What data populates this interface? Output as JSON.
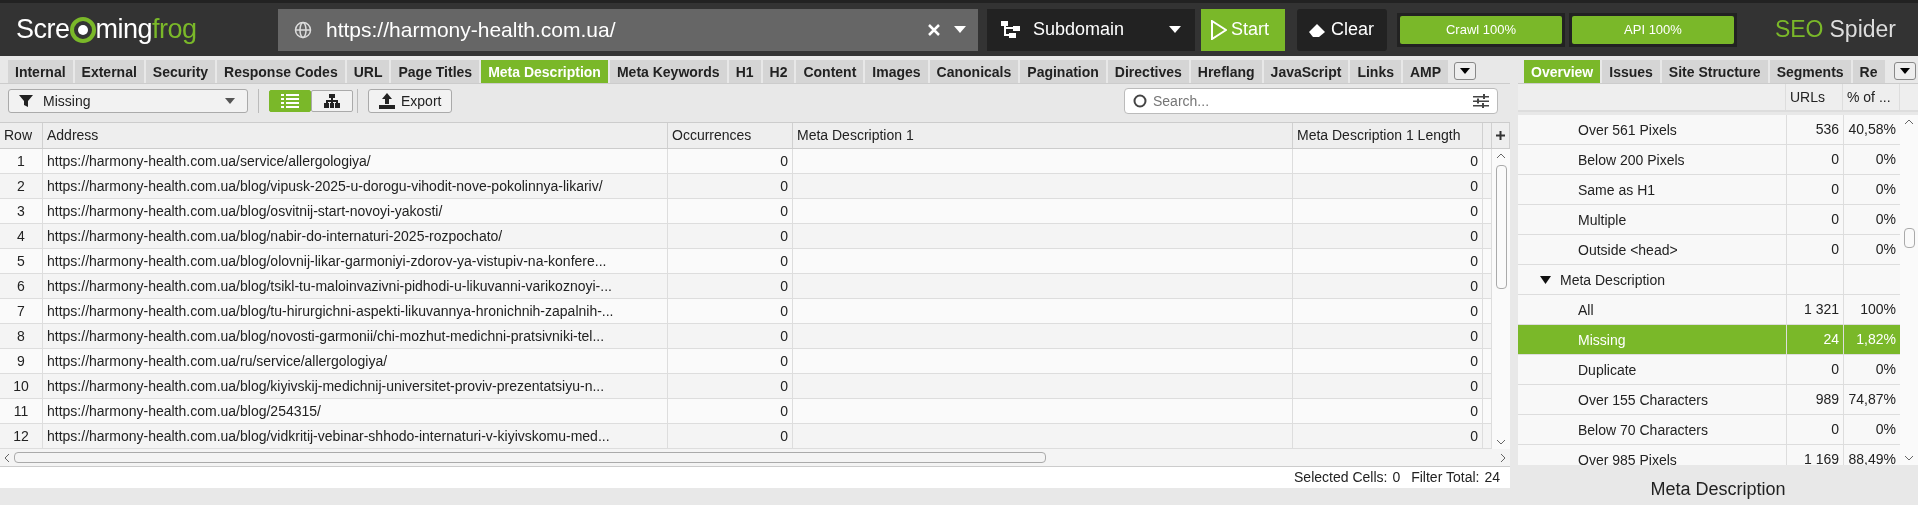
{
  "logo": {
    "part_1": "Scre",
    "part_2": "ming",
    "part_3": "frog"
  },
  "url_field": {
    "value": "https://harmony-health.com.ua/"
  },
  "mode_dropdown": {
    "value": "Subdomain"
  },
  "buttons": {
    "start": "Start",
    "clear": "Clear"
  },
  "progress": [
    {
      "label": "Crawl 100%",
      "level": 1
    },
    {
      "label": "API 100%",
      "level": 1
    }
  ],
  "product": {
    "part_1": "SEO",
    "part_2": "Spider"
  },
  "tabs": [
    {
      "label": "Internal",
      "selected": false
    },
    {
      "label": "External",
      "selected": false
    },
    {
      "label": "Security",
      "selected": false
    },
    {
      "label": "Response Codes",
      "selected": false
    },
    {
      "label": "URL",
      "selected": false
    },
    {
      "label": "Page Titles",
      "selected": false
    },
    {
      "label": "Meta Description",
      "selected": true
    },
    {
      "label": "Meta Keywords",
      "selected": false
    },
    {
      "label": "H1",
      "selected": false
    },
    {
      "label": "H2",
      "selected": false
    },
    {
      "label": "Content",
      "selected": false
    },
    {
      "label": "Images",
      "selected": false
    },
    {
      "label": "Canonicals",
      "selected": false
    },
    {
      "label": "Pagination",
      "selected": false
    },
    {
      "label": "Directives",
      "selected": false
    },
    {
      "label": "Hreflang",
      "selected": false
    },
    {
      "label": "JavaScript",
      "selected": false
    },
    {
      "label": "Links",
      "selected": false
    },
    {
      "label": "AMP",
      "selected": false
    }
  ],
  "filter": {
    "value": "Missing"
  },
  "view_buttons": [
    {
      "kind": "list",
      "selected": true
    },
    {
      "kind": "tree",
      "selected": false
    }
  ],
  "export_button": "Export",
  "search": {
    "placeholder": "Search..."
  },
  "table": {
    "columns": [
      "Row",
      "Address",
      "Occurrences",
      "Meta Description 1",
      "Meta Description 1 Length"
    ],
    "rows": [
      {
        "row": "1",
        "address": "https://harmony-health.com.ua/service/allergologiya/",
        "occurrences": "0",
        "length": "0"
      },
      {
        "row": "2",
        "address": "https://harmony-health.com.ua/blog/vipusk-2025-u-dorogu-vihodit-nove-pokolinnya-likariv/",
        "occurrences": "0",
        "length": "0"
      },
      {
        "row": "3",
        "address": "https://harmony-health.com.ua/blog/osvitnij-start-novoyi-yakosti/",
        "occurrences": "0",
        "length": "0"
      },
      {
        "row": "4",
        "address": "https://harmony-health.com.ua/blog/nabir-do-internaturi-2025-rozpochato/",
        "occurrences": "0",
        "length": "0"
      },
      {
        "row": "5",
        "address": "https://harmony-health.com.ua/blog/olovnij-likar-garmoniyi-zdorov-ya-vistupiv-na-konfere...",
        "occurrences": "0",
        "length": "0"
      },
      {
        "row": "6",
        "address": "https://harmony-health.com.ua/blog/tsikl-tu-maloinvazivni-pidhodi-u-likuvanni-varikoznoyi-...",
        "occurrences": "0",
        "length": "0"
      },
      {
        "row": "7",
        "address": "https://harmony-health.com.ua/blog/tu-hirurgichni-aspekti-likuvannya-hronichnih-zapalnih-...",
        "occurrences": "0",
        "length": "0"
      },
      {
        "row": "8",
        "address": "https://harmony-health.com.ua/blog/novosti-garmonii/chi-mozhut-medichni-pratsivniki-tel...",
        "occurrences": "0",
        "length": "0"
      },
      {
        "row": "9",
        "address": "https://harmony-health.com.ua/ru/service/allergologiya/",
        "occurrences": "0",
        "length": "0"
      },
      {
        "row": "10",
        "address": "https://harmony-health.com.ua/blog/kiyivskij-medichnij-universitet-proviv-prezentatsiyu-n...",
        "occurrences": "0",
        "length": "0"
      },
      {
        "row": "11",
        "address": "https://harmony-health.com.ua/blog/254315/",
        "occurrences": "0",
        "length": "0"
      },
      {
        "row": "12",
        "address": "https://harmony-health.com.ua/blog/vidkritij-vebinar-shhodo-internaturi-v-kiyivskomu-med...",
        "occurrences": "0",
        "length": "0"
      }
    ]
  },
  "status_bar": {
    "selected_label": "Selected Cells:",
    "selected_value": "0",
    "total_label": "Filter Total:",
    "total_value": "24"
  },
  "right_tabs": [
    {
      "label": "Overview",
      "selected": true
    },
    {
      "label": "Issues",
      "selected": false
    },
    {
      "label": "Site Structure",
      "selected": false
    },
    {
      "label": "Segments",
      "selected": false
    },
    {
      "label": "Re",
      "selected": false
    }
  ],
  "overview": {
    "columns": [
      "URLs",
      "% of ..."
    ],
    "items": [
      {
        "label": "Over 561 Pixels",
        "urls": "536",
        "percent": "40,58%",
        "selected": false
      },
      {
        "label": "Below 200 Pixels",
        "urls": "0",
        "percent": "0%",
        "selected": false
      },
      {
        "label": "Same as H1",
        "urls": "0",
        "percent": "0%",
        "selected": false
      },
      {
        "label": "Multiple",
        "urls": "0",
        "percent": "0%",
        "selected": false
      },
      {
        "label": "Outside <head>",
        "urls": "0",
        "percent": "0%",
        "selected": false
      }
    ],
    "group": {
      "label": "Meta Description",
      "expanded": true,
      "children": [
        {
          "label": "All",
          "urls": "1 321",
          "percent": "100%",
          "selected": false
        },
        {
          "label": "Missing",
          "urls": "24",
          "percent": "1,82%",
          "selected": true
        },
        {
          "label": "Duplicate",
          "urls": "0",
          "percent": "0%",
          "selected": false
        },
        {
          "label": "Over 155 Characters",
          "urls": "989",
          "percent": "74,87%",
          "selected": false
        },
        {
          "label": "Below 70 Characters",
          "urls": "0",
          "percent": "0%",
          "selected": false
        },
        {
          "label": "Over 985 Pixels",
          "urls": "1 169",
          "percent": "88,49%",
          "selected": false
        }
      ]
    }
  },
  "chart_title": "Meta Description"
}
